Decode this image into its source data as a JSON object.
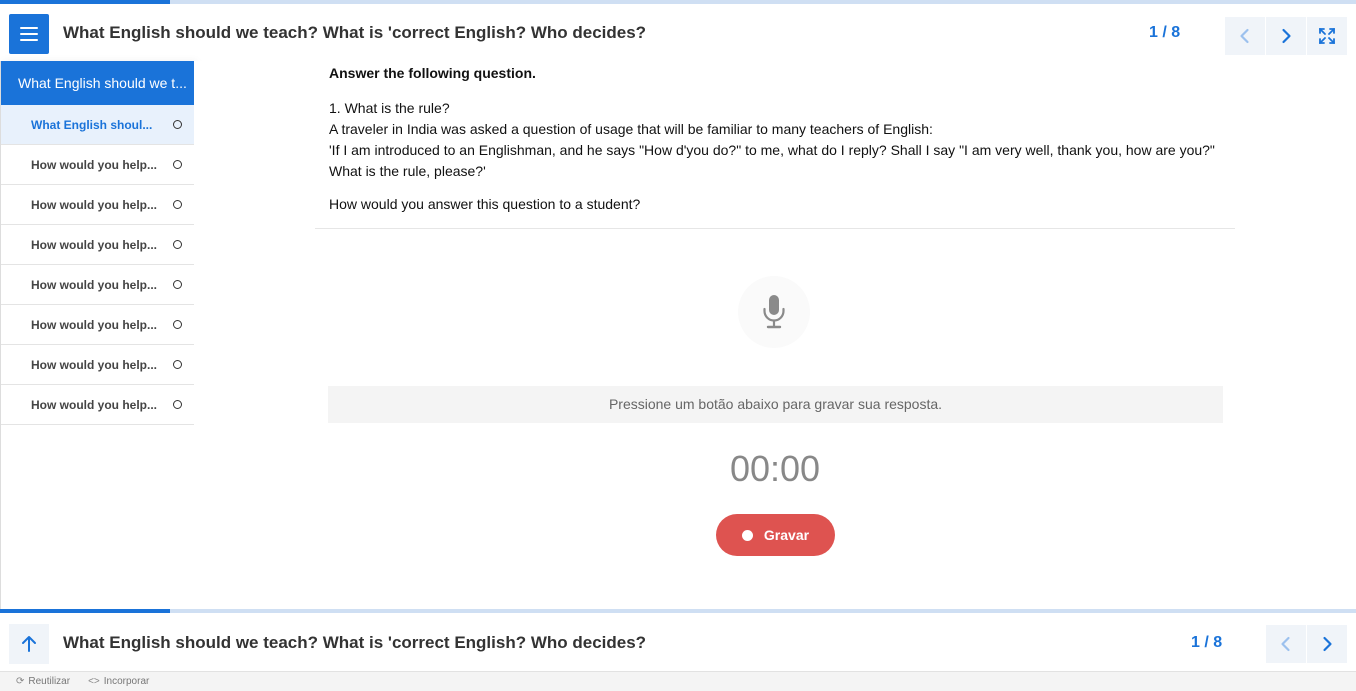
{
  "header": {
    "title": "What English should we teach? What is 'correct English? Who decides?",
    "counter": "1 / 8",
    "icons": {
      "menu": "menu-icon",
      "prev": "chevron-left-icon",
      "next": "chevron-right-icon",
      "fullscreen": "fullscreen-icon"
    }
  },
  "sidebar": {
    "heading": "What English should we t...",
    "items": [
      {
        "label": "What English shoul...",
        "active": true
      },
      {
        "label": "How would you help..."
      },
      {
        "label": "How would you help..."
      },
      {
        "label": "How would you help..."
      },
      {
        "label": "How would you help..."
      },
      {
        "label": "How would you help..."
      },
      {
        "label": "How would you help..."
      },
      {
        "label": "How would you help..."
      }
    ]
  },
  "question": {
    "instruction": "Answer the following question.",
    "lines": [
      "1. What  is the rule?",
      "A traveler in India was asked a question of usage that will be familiar to many teachers of English:",
      "'If I am introduced to an Englishman, and he says \"How d'you do?\" to me, what do I reply? Shall I say \"I am very well, thank you, how are you?\"",
      "What is the rule, please?'"
    ],
    "ask": "How would you answer this question to a student?"
  },
  "recorder": {
    "hint": "Pressione um botão abaixo para gravar sua resposta.",
    "timer": "00:00",
    "record_label": "Gravar",
    "icon": "microphone-icon"
  },
  "bottom": {
    "title": "What English should we teach? What is 'correct English? Who decides?",
    "counter": "1 / 8"
  },
  "footer": {
    "reuse": "Reutilizar",
    "embed": "Incorporar"
  },
  "colors": {
    "accent": "#1a73d9",
    "record": "#de5350"
  }
}
